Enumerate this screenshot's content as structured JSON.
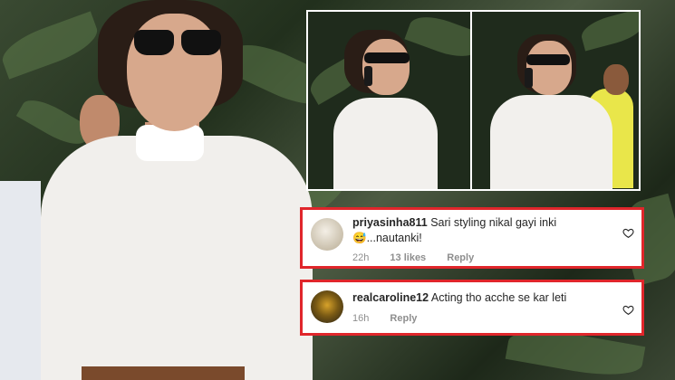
{
  "comments": [
    {
      "username": "priyasinha811",
      "text_line1": "Sari styling nikal gayi inki",
      "text_line2": "😅...nautanki!",
      "time": "22h",
      "likes": "13 likes",
      "reply_label": "Reply",
      "avatar_icon": "avatar-photo"
    },
    {
      "username": "realcaroline12",
      "text_line1": "Acting tho acche se kar leti",
      "time": "16h",
      "reply_label": "Reply",
      "avatar_icon": "avatar-photo"
    }
  ],
  "colors": {
    "highlight_border": "#e0262b",
    "meta_gray": "#8e8e8e",
    "text": "#262626"
  }
}
